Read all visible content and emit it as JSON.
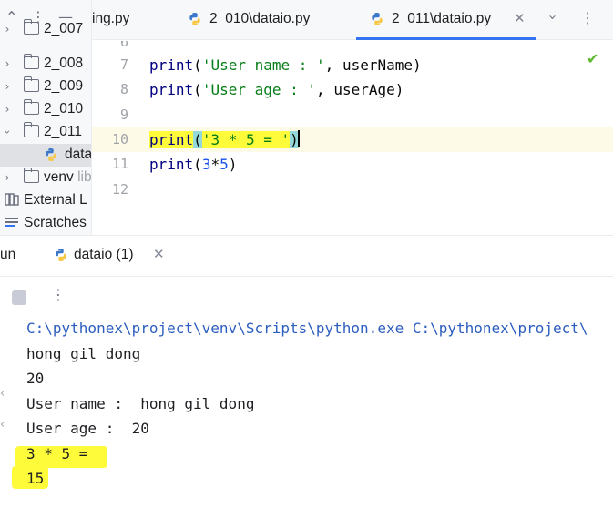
{
  "project_tree": {
    "items": [
      {
        "label": "2_007",
        "type": "folder",
        "expanded": false
      },
      {
        "label": "2_008",
        "type": "folder",
        "expanded": false
      },
      {
        "label": "2_009",
        "type": "folder",
        "expanded": false
      },
      {
        "label": "2_010",
        "type": "folder",
        "expanded": false
      },
      {
        "label": "2_011",
        "type": "folder",
        "expanded": true
      },
      {
        "label": "datai",
        "type": "python-file",
        "selected": true
      },
      {
        "label": "venv",
        "hint": "lib",
        "type": "folder",
        "expanded": false
      },
      {
        "label": "External L",
        "type": "library"
      },
      {
        "label": "Scratches",
        "type": "scratches"
      }
    ]
  },
  "tabs": [
    {
      "label": "ing.py",
      "active": false
    },
    {
      "label": "2_010\\dataio.py",
      "active": false
    },
    {
      "label": "2_011\\dataio.py",
      "active": true
    }
  ],
  "editor": {
    "partial_line_number": "6",
    "lines": [
      {
        "number": "7",
        "text": "print('User name : ', userName)"
      },
      {
        "number": "8",
        "text": "print('User age : ', userAge)"
      },
      {
        "number": "9",
        "text": ""
      },
      {
        "number": "10",
        "text": "print('3 * 5 = ')"
      },
      {
        "number": "11",
        "text": "print(3*5)"
      },
      {
        "number": "12",
        "text": ""
      }
    ]
  },
  "run": {
    "title": "un",
    "tab_label": "dataio (1)",
    "output": [
      "C:\\pythonex\\project\\venv\\Scripts\\python.exe C:\\pythonex\\project\\",
      "hong gil dong",
      "20",
      "User name :  hong gil dong",
      "User age :  20",
      "3 * 5 = ",
      "15"
    ]
  },
  "colors": {
    "accent": "#3574f0",
    "highlight": "#fefb3a",
    "string": "#067d17",
    "number": "#1750eb"
  }
}
